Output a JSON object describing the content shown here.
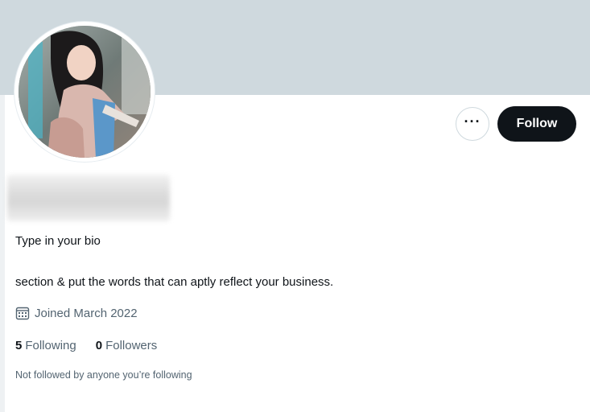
{
  "profile": {
    "avatar_alt": "Profile photo",
    "bio_lines": [
      "Type in your bio",
      "section & put the words that can aptly reflect your business."
    ],
    "joined": "Joined March 2022",
    "following_count": "5",
    "following_label": "Following",
    "followers_count": "0",
    "followers_label": "Followers",
    "not_followed_text": "Not followed by anyone you’re following"
  },
  "actions": {
    "more_label": "···",
    "follow_label": "Follow"
  },
  "colors": {
    "banner": "#cfd9de",
    "follow_button": "#0f1419",
    "secondary_text": "#536471"
  },
  "icons": {
    "joined": "calendar-icon",
    "more": "more-horizontal-icon"
  }
}
